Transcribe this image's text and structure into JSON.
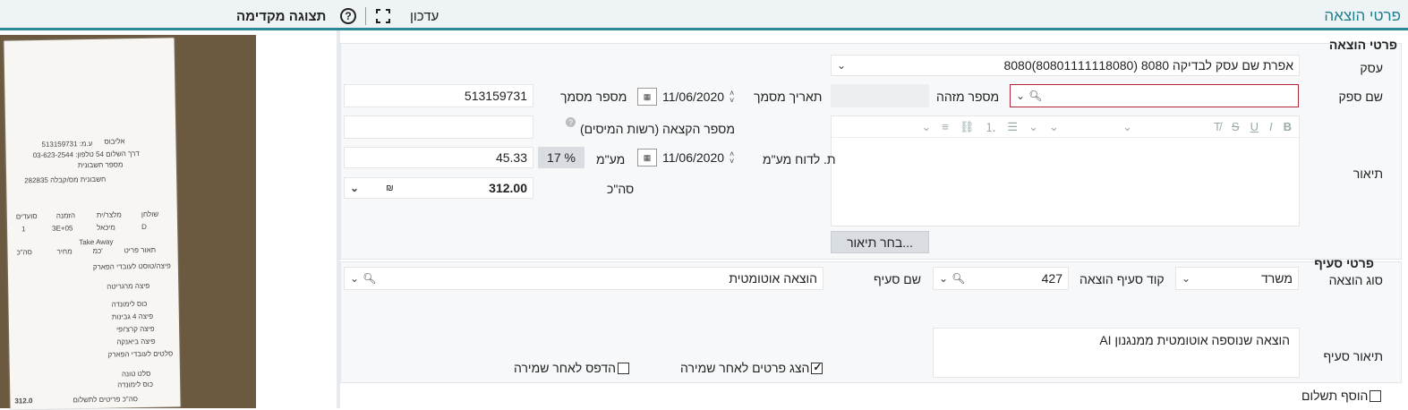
{
  "header": {
    "title": "פרטי הוצאה",
    "update_label": "עדכון",
    "preview_label": "תצוגה מקדימה"
  },
  "section1": {
    "title": "פרטי הוצאה",
    "business_label": "עסק",
    "business_value": "8080אפרת שם עסק לבדיקה 8080 (80801111118080)",
    "supplier_label": "שם ספק",
    "supplier_value": "",
    "id_label": "מספר מזהה",
    "id_value": "",
    "doc_date_label": "תאריך מסמך",
    "doc_date_value": "11/06/2020",
    "doc_num_label": "מספר מסמך",
    "doc_num_value": "513159731",
    "alloc_label": "מספר הקצאה (רשות המיסים)",
    "alloc_value": "",
    "description_label": "תיאור",
    "vat_report_label": "ת. לדוח מע\"מ",
    "vat_report_date": "11/06/2020",
    "vat_label": "מע\"מ",
    "vat_percent": "17 %",
    "vat_value": "45.33",
    "total_label": "סה\"כ",
    "total_value": "312.00",
    "currency": "₪",
    "choose_desc_button": "בחר תיאור..."
  },
  "section2": {
    "title": "פרטי סעיף",
    "expense_type_label": "סוג הוצאה",
    "expense_type_value": "משרד",
    "expense_code_label": "קוד סעיף הוצאה",
    "expense_code_value": "427",
    "clause_name_label": "שם סעיף",
    "clause_name_value": "הוצאה אוטומטית",
    "clause_desc_label": "תיאור סעיף",
    "clause_desc_value": "הוצאה שנוספה אוטומטית ממנגנון AI",
    "show_details_label": "הצג פרטים לאחר שמירה",
    "show_details_checked": true,
    "print_label": "הדפס לאחר שמירה",
    "print_checked": false
  },
  "add_payment_label": "הוסף תשלום",
  "receipt": {
    "lines": [
      "אליבוס",
      "513159731 :ע.מ",
      "דרך השלום 54 טלפון: 03-623-2544",
      "מספר חשבונית",
      "חשבונית מס/קבלה 282835",
      "שולחן",
      "מלצר/ית",
      "הזמנה",
      "סועדים",
      "D",
      "מיכאל",
      "3E+05",
      "1",
      "Take Away",
      "תאור פריט",
      "כמ'",
      "מחיר",
      "סה\"כ",
      "פיצה/טוסט לעובדי הפארק",
      "פיצה מרגריטה",
      "כוס לימונדה",
      "פיצה 4 גבינות",
      "פיצה קרצ'ופי",
      "פיצה ביאנקה",
      "סלטים לעובדי הפארק",
      "סלט טונה",
      "כוס לימונדה",
      "סה\"כ פריטים לתשלום",
      "312.0"
    ]
  }
}
